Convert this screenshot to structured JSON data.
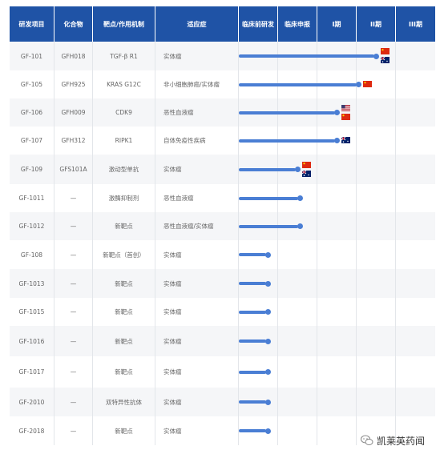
{
  "header": {
    "columns": [
      "研发项目",
      "化合物",
      "靶点/作用机制",
      "适应症",
      "临床前研发",
      "临床申报",
      "I期",
      "II期",
      "III期"
    ]
  },
  "rows": [
    {
      "id": "GF-101",
      "compound": "GFH018",
      "target": "TGF-β R1",
      "indication": "实体瘤",
      "progress": 3.45,
      "flags": [
        "china-flag",
        "australia-flag"
      ]
    },
    {
      "id": "GF-105",
      "compound": "GFH925",
      "target": "KRAS G12C",
      "indication": "非小细胞肺癌/实体瘤",
      "progress": 3.0,
      "flags": [
        "china-flag"
      ]
    },
    {
      "id": "GF-106",
      "compound": "GFH009",
      "target": "CDK9",
      "indication": "恶性血液瘤",
      "progress": 2.45,
      "flags": [
        "usa-flag",
        "china-flag"
      ]
    },
    {
      "id": "GF-107",
      "compound": "GFH312",
      "target": "RIPK1",
      "indication": "自体免疫性疾病",
      "progress": 2.45,
      "flags": [
        "australia-flag"
      ]
    },
    {
      "id": "GF-109",
      "compound": "GFS101A",
      "target": "激动型单抗",
      "indication": "实体瘤",
      "progress": 1.45,
      "flags": [
        "china-flag",
        "australia-flag"
      ]
    },
    {
      "id": "GF-1011",
      "compound": "—",
      "target": "激酶抑制剂",
      "indication": "恶性血液瘤",
      "progress": 1.5,
      "flags": []
    },
    {
      "id": "GF-1012",
      "compound": "—",
      "target": "新靶点",
      "indication": "恶性血液瘤/实体瘤",
      "progress": 1.5,
      "flags": []
    },
    {
      "id": "GF-108",
      "compound": "—",
      "target": "新靶点（首创）",
      "indication": "实体瘤",
      "progress": 0.7,
      "flags": []
    },
    {
      "id": "GF-1013",
      "compound": "—",
      "target": "新靶点",
      "indication": "实体瘤",
      "progress": 0.7,
      "flags": []
    },
    {
      "id": "GF-1015",
      "compound": "—",
      "target": "新靶点",
      "indication": "实体瘤",
      "progress": 0.7,
      "flags": []
    },
    {
      "id": "GF-1016",
      "compound": "—",
      "target": "新靶点",
      "indication": "实体瘤",
      "progress": 0.7,
      "flags": []
    },
    {
      "id": "GF-1017",
      "compound": "—",
      "target": "新靶点",
      "indication": "实体瘤",
      "progress": 0.7,
      "flags": []
    },
    {
      "id": "GF-2010",
      "compound": "—",
      "target": "双特异性抗体",
      "indication": "实体瘤",
      "progress": 0.7,
      "flags": []
    },
    {
      "id": "GF-2018",
      "compound": "—",
      "target": "新靶点",
      "indication": "实体瘤",
      "progress": 0.7,
      "flags": []
    }
  ],
  "colors": {
    "header": "#1f53a6",
    "bar": "#4a7ed4",
    "alt_row": "#f5f6f8"
  },
  "watermark": {
    "text": "凯莱英药闻",
    "icon": "wechat-icon"
  }
}
